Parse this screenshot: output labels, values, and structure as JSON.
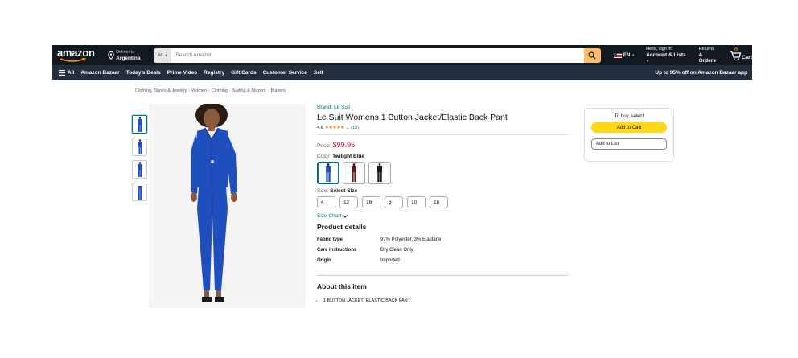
{
  "header": {
    "logo_text": "amazon",
    "deliver_small": "Deliver to",
    "deliver_big": "Argentina",
    "search_category": "All",
    "search_placeholder": "Search Amazon",
    "language": "EN",
    "account_small": "Hello, sign in",
    "account_big": "Account & Lists",
    "returns_small": "Returns",
    "returns_big": "& Orders",
    "cart_count": "0",
    "cart_label": "Cart"
  },
  "nav": {
    "all_label": "All",
    "items": [
      "Amazon Bazaar",
      "Today's Deals",
      "Prime Video",
      "Registry",
      "Gift Cards",
      "Customer Service",
      "Sell"
    ],
    "promo": "Up to 95% off on Amazon Bazaar app"
  },
  "breadcrumb": [
    "Clothing, Shoes & Jewelry",
    "Women",
    "Clothing",
    "Suiting & Blazers",
    "Blazers"
  ],
  "product": {
    "brand": "Brand: Le Suit",
    "title": "Le Suit Womens 1 Button Jacket/Elastic Back Pant",
    "rating": "4.6",
    "stars": "★★★★★",
    "rating_count": "(15)",
    "price_label": "Price:",
    "price": "$99.95",
    "color_label": "Color:",
    "color_value": "Twilight Blue",
    "size_label": "Size:",
    "size_value": "Select Size",
    "sizes": [
      "4",
      "12",
      "16",
      "6",
      "10",
      "18"
    ],
    "size_chart": "Size Chart",
    "details_heading": "Product details",
    "details": [
      {
        "key": "Fabric type",
        "value": "97% Polyester, 3% Elastane"
      },
      {
        "key": "Care instructions",
        "value": "Dry Clean Only"
      },
      {
        "key": "Origin",
        "value": "Imported"
      }
    ],
    "about_heading": "About this item",
    "about_items": [
      "1 BUTTON JACKET/ ELASTIC BACK PANT"
    ]
  },
  "buybox": {
    "heading": "To buy, select",
    "add_to_cart": "Add to Cart",
    "add_to_list": "Add to List"
  },
  "colors": {
    "nav_top": "#131921",
    "nav_bottom": "#232f3e",
    "search_button": "#febd69",
    "suit_blue": "#1f4fbf",
    "price_red": "#cc0c39",
    "link": "#007185",
    "add_to_cart": "#ffd814"
  }
}
